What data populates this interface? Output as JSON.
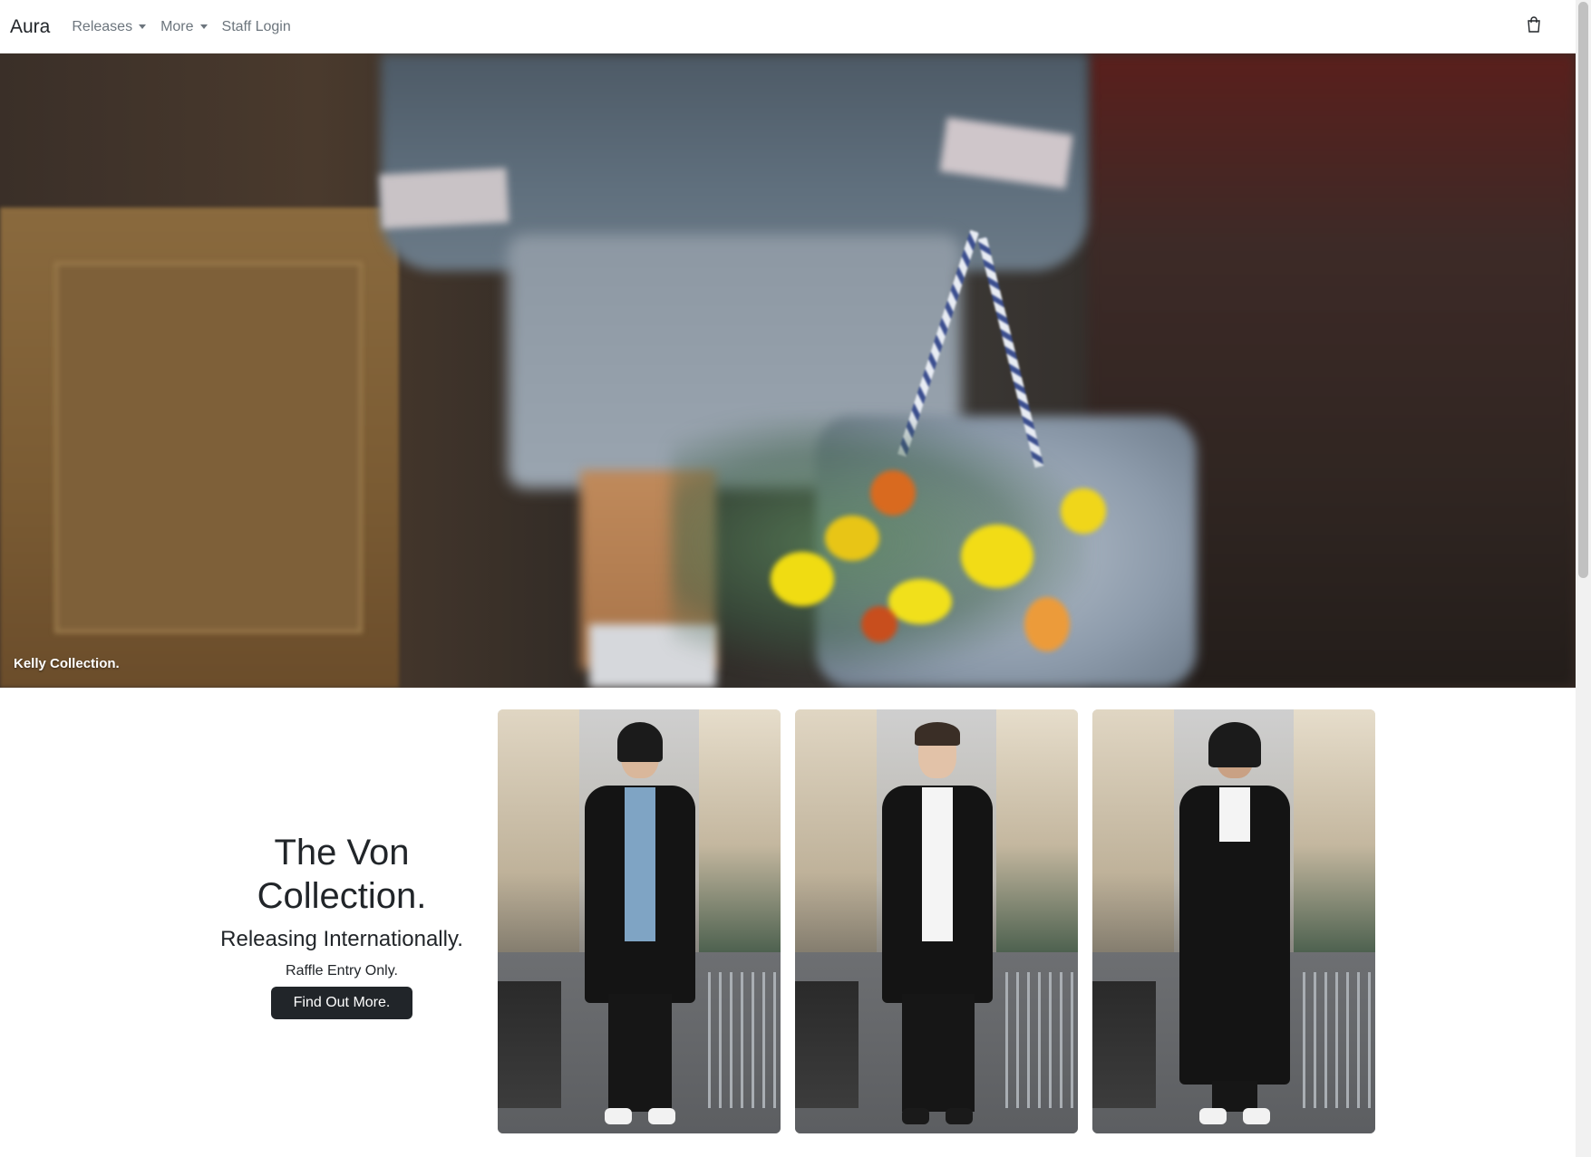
{
  "navbar": {
    "brand": "Aura",
    "items": [
      {
        "label": "Releases",
        "dropdown": true
      },
      {
        "label": "More",
        "dropdown": true
      },
      {
        "label": "Staff Login",
        "dropdown": false
      }
    ],
    "cart_icon": "shopping-bag-icon"
  },
  "hero": {
    "caption": "Kelly Collection."
  },
  "release": {
    "title": "The Von Collection.",
    "subtitle": "Releasing Internationally.",
    "note": "Raffle Entry Only.",
    "button_label": "Find Out More.",
    "looks": [
      {
        "shirt_color": "#7fa4c4"
      },
      {
        "shirt_color": "#f4f4f4"
      },
      {
        "shirt_color": "#f4f4f4"
      }
    ]
  },
  "colors": {
    "button_bg": "#212529",
    "text": "#212529",
    "nav_muted": "#6c757d"
  }
}
